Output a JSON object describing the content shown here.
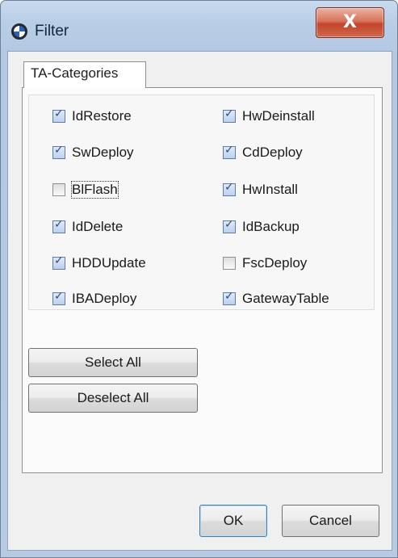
{
  "window": {
    "title": "Filter",
    "close_glyph": "X"
  },
  "tabs": [
    {
      "label": "TA-Categories",
      "active": true
    }
  ],
  "categories": {
    "left": [
      {
        "label": "IdRestore",
        "checked": true
      },
      {
        "label": "SwDeploy",
        "checked": true
      },
      {
        "label": "BlFlash",
        "checked": false,
        "focused": true
      },
      {
        "label": "IdDelete",
        "checked": true
      },
      {
        "label": "HDDUpdate",
        "checked": true
      },
      {
        "label": "IBADeploy",
        "checked": true
      }
    ],
    "right": [
      {
        "label": "HwDeinstall",
        "checked": true
      },
      {
        "label": "CdDeploy",
        "checked": true
      },
      {
        "label": "HwInstall",
        "checked": true
      },
      {
        "label": "IdBackup",
        "checked": true
      },
      {
        "label": "FscDeploy",
        "checked": false
      },
      {
        "label": "GatewayTable",
        "checked": true
      }
    ]
  },
  "buttons": {
    "select_all": "Select All",
    "deselect_all": "Deselect All",
    "ok": "OK",
    "cancel": "Cancel"
  },
  "icons": {
    "app": "globe-icon",
    "close": "close-icon",
    "checkmark": "✓"
  }
}
